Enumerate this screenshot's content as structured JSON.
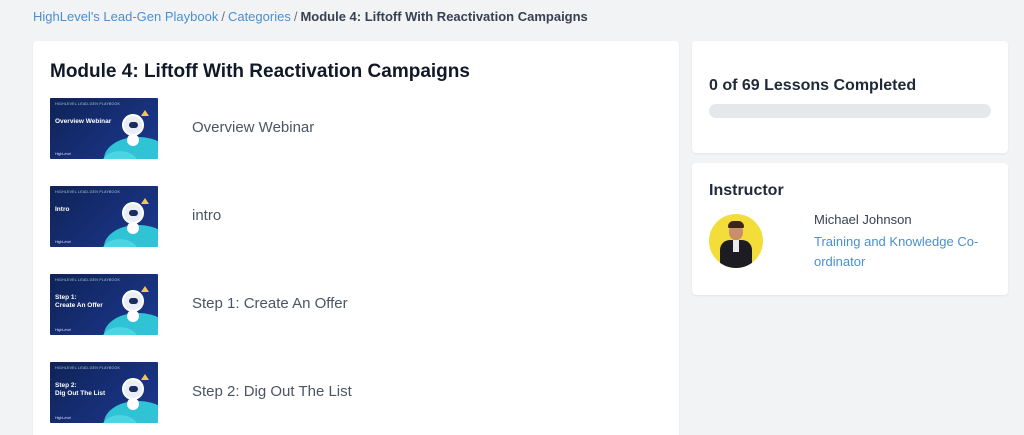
{
  "breadcrumb": {
    "items": [
      "HighLevel's Lead-Gen Playbook",
      "Categories"
    ],
    "separator": "/",
    "current": "Module 4: Liftoff With Reactivation Campaigns"
  },
  "module": {
    "title": "Module 4: Liftoff With Reactivation Campaigns",
    "lessons": [
      {
        "title": "Overview Webinar",
        "thumb_text": "Overview Webinar"
      },
      {
        "title": "intro",
        "thumb_text": "Intro"
      },
      {
        "title": "Step 1: Create An Offer",
        "thumb_text": "Step 1:\nCreate An Offer"
      },
      {
        "title": "Step 2: Dig Out The List",
        "thumb_text": "Step 2:\nDig Out The List"
      }
    ]
  },
  "progress": {
    "text": "0 of 69 Lessons Completed",
    "completed": 0,
    "total": 69
  },
  "instructor": {
    "heading": "Instructor",
    "name": "Michael Johnson",
    "role": "Training and Knowledge Co-ordinator"
  },
  "colors": {
    "link": "#4a8fd1",
    "background": "#f2f3f5",
    "thumb_navy": "#17307a",
    "thumb_accent": "#2ec4d6",
    "avatar_bg": "#f2dd3a"
  },
  "icons": {
    "thumbnail": "robot-astronaut-thumbnail"
  }
}
